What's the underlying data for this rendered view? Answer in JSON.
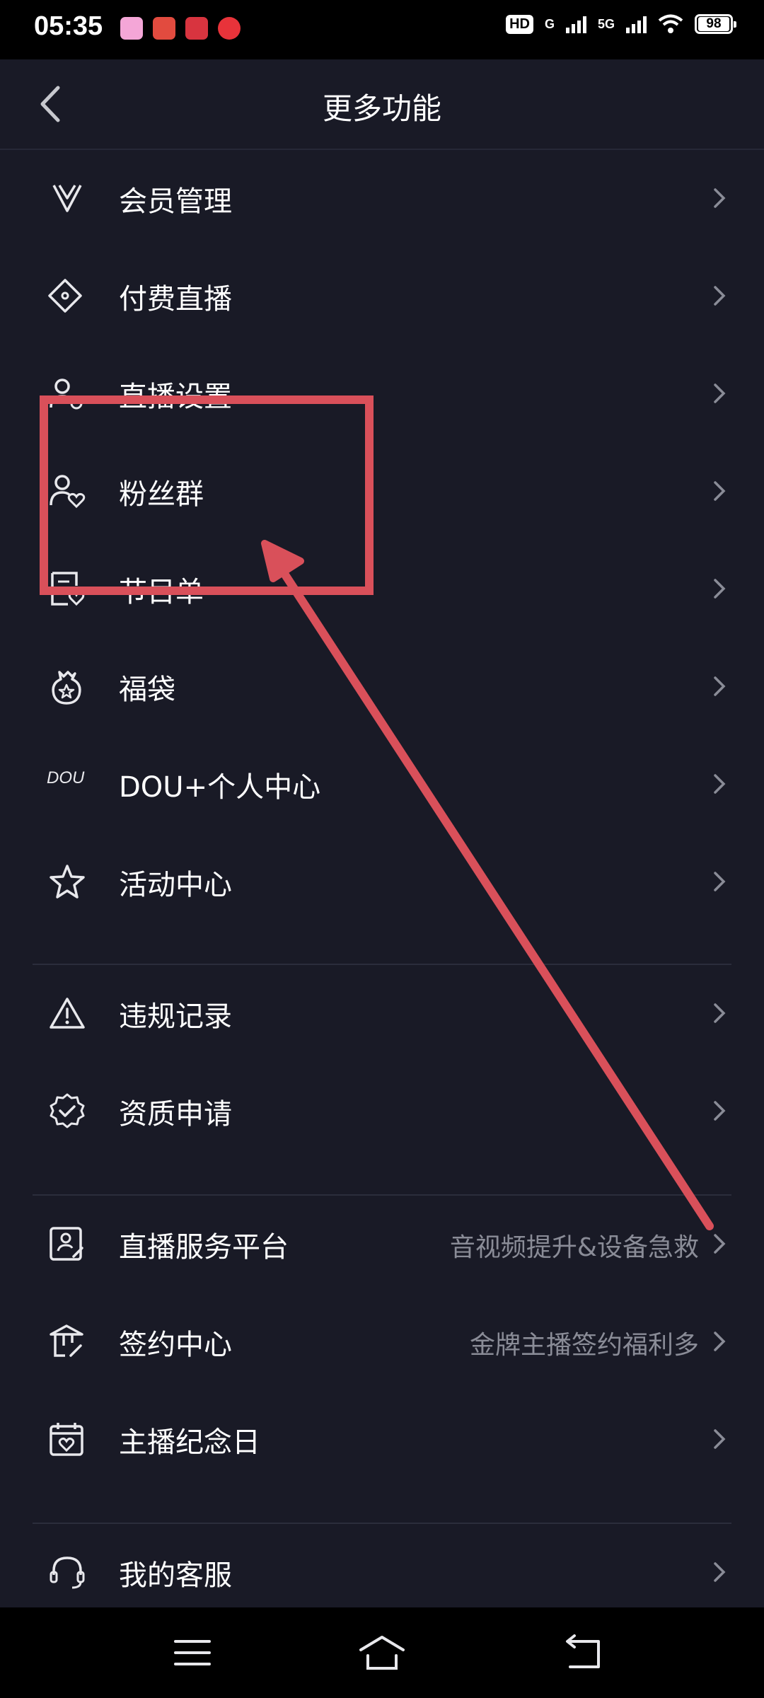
{
  "status_bar": {
    "time": "05:35",
    "hd_badge": "HD",
    "network_a": "G",
    "network_b": "5G",
    "battery": "98"
  },
  "header": {
    "title": "更多功能"
  },
  "menu": [
    {
      "label": "会员管理",
      "icon": "vip-icon",
      "hint": ""
    },
    {
      "label": "付费直播",
      "icon": "ticket-icon",
      "hint": ""
    },
    {
      "label": "直播设置",
      "icon": "user-settings-icon",
      "hint": ""
    },
    {
      "label": "粉丝群",
      "icon": "fan-group-icon",
      "hint": ""
    },
    {
      "label": "节目单",
      "icon": "program-list-icon",
      "hint": ""
    },
    {
      "label": "福袋",
      "icon": "lucky-bag-icon",
      "hint": ""
    },
    {
      "label": "DOU+个人中心",
      "icon": "dou-plus-icon",
      "hint": ""
    },
    {
      "label": "活动中心",
      "icon": "star-icon",
      "hint": ""
    },
    {
      "label": "违规记录",
      "icon": "warning-icon",
      "hint": ""
    },
    {
      "label": "资质申请",
      "icon": "verified-badge-icon",
      "hint": ""
    },
    {
      "label": "直播服务平台",
      "icon": "service-platform-icon",
      "hint": "音视频提升&设备急救"
    },
    {
      "label": "签约中心",
      "icon": "contract-icon",
      "hint": "金牌主播签约福利多"
    },
    {
      "label": "主播纪念日",
      "icon": "calendar-heart-icon",
      "hint": ""
    },
    {
      "label": "我的客服",
      "icon": "headset-icon",
      "hint": ""
    }
  ],
  "dou_icon_text": "DOU",
  "colors": {
    "background": "#191a26",
    "annotation": "#d9505a",
    "hint_text": "#8a8c97"
  }
}
